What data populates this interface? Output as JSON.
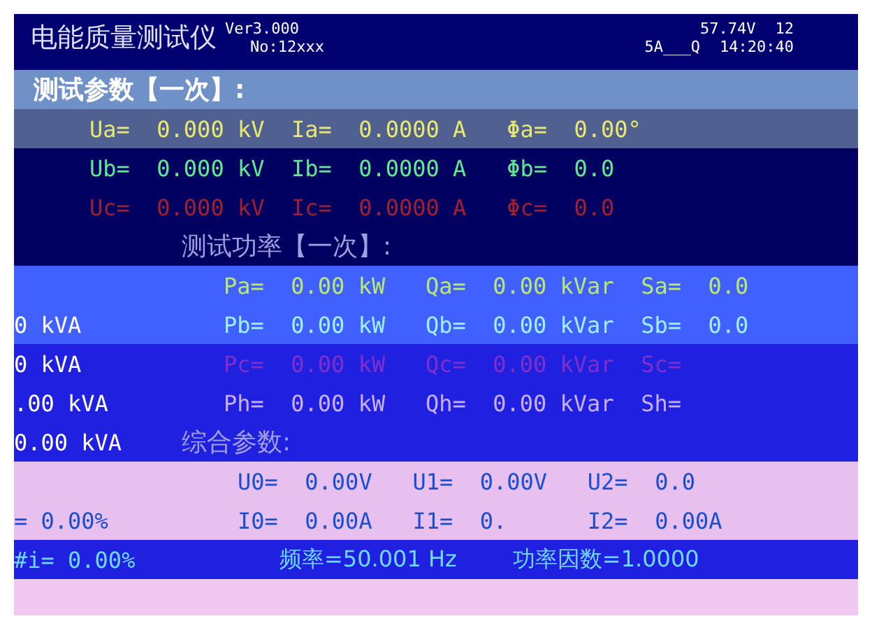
{
  "header": {
    "title": "电能质量测试仪",
    "version": "Ver3.000",
    "serial": "No:12xxx",
    "voltage": "57.74V",
    "code": "12",
    "range": "5A___Q",
    "time": "14:20:40"
  },
  "sections": [
    {
      "title": "测试参数【一次】:",
      "rows": [
        {
          "color": "#e8e870",
          "cells": [
            "Ua=",
            "0.000 kV",
            "Ia=",
            "0.0000 A",
            "Φa=",
            "0.00°"
          ]
        },
        {
          "color": "#60e890",
          "cells": [
            "Ub=",
            "0.000 kV",
            "Ib=",
            "0.0000 A",
            "Φb=",
            "0.0"
          ]
        },
        {
          "color": "#a02030",
          "cells": [
            "Uc=",
            "0.000 kV",
            "Ic=",
            "0.0000 A",
            "Φc=",
            "0.0"
          ]
        }
      ]
    },
    {
      "title": "测试功率【一次】:",
      "rows": [
        {
          "color": "#b8e870",
          "cells": [
            "Pa=",
            "0.00 kW",
            "Qa=",
            "0.00 kVar",
            "Sa=",
            "0.0"
          ]
        },
        {
          "color": "#a0f0ff",
          "side": "0 kVA",
          "cells": [
            "Pb=",
            "0.00 kW",
            "Qb=",
            "0.00 kVar",
            "Sb=",
            "0.0"
          ]
        },
        {
          "color": "#8030c8",
          "side": "0 kVA",
          "cells": [
            "Pc=",
            "0.00 kW",
            "Qc=",
            "0.00 kVar",
            "Sc="
          ]
        },
        {
          "color": "#c8b0ff",
          "side": ".00 kVA",
          "cells": [
            "Ph=",
            "0.00 kW",
            "Qh=",
            "0.00 kVar",
            "Sh="
          ]
        }
      ]
    },
    {
      "title": "综合参数:",
      "side": "0.00 kVA",
      "rows": [
        {
          "color": "#1a50d0",
          "cells": [
            "U0=",
            "0.00V",
            "U1=",
            "0.00V",
            "U2=",
            "0.0"
          ]
        },
        {
          "color": "#1a50d0",
          "side": "= 0.00%",
          "cells": [
            "I0=",
            "0.00A",
            "I1=",
            "0.",
            "I2=",
            "0.00A"
          ]
        }
      ]
    }
  ],
  "summary": {
    "side": "#i= 0.00%",
    "frequency": "频率=50.001 Hz",
    "power_factor": "功率因数=1.0000"
  }
}
